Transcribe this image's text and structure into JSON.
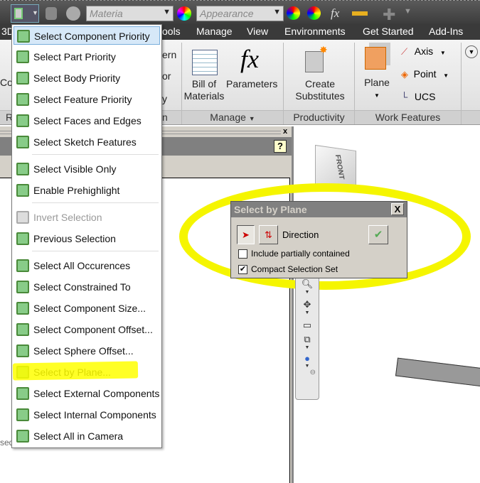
{
  "quick_access": {
    "material_placeholder": "Materia",
    "appearance_placeholder": "Appearance",
    "fx_icon": "fx"
  },
  "tabs": [
    "3D",
    "ools",
    "Manage",
    "View",
    "Environments",
    "Get Started",
    "Add-Ins"
  ],
  "ribbon": {
    "partial_labels": [
      "Co",
      "R",
      "ern",
      "or",
      "y",
      "n"
    ],
    "bill_of_materials": "Bill of Materials",
    "parameters": "Parameters",
    "create_substitutes": "Create Substitutes",
    "plane": "Plane",
    "axis": "Axis",
    "point": "Point",
    "ucs": "UCS",
    "groups": {
      "manage": "Manage",
      "productivity": "Productivity",
      "work_features": "Work Features"
    }
  },
  "panel": {
    "close": "x",
    "help": "?",
    "partial_text": "sed"
  },
  "menu": {
    "items": [
      {
        "label": "Select Component Priority",
        "highlighted": true
      },
      {
        "label": "Select Part Priority"
      },
      {
        "label": "Select Body Priority"
      },
      {
        "label": "Select Feature Priority"
      },
      {
        "label": "Select Faces and Edges"
      },
      {
        "label": "Select Sketch Features"
      },
      {
        "label": "Select Visible Only"
      },
      {
        "label": "Enable Prehighlight"
      },
      {
        "label": "Invert Selection",
        "disabled": true
      },
      {
        "label": "Previous Selection"
      },
      {
        "label": "Select All Occurences"
      },
      {
        "label": "Select Constrained To"
      },
      {
        "label": "Select Component Size..."
      },
      {
        "label": "Select Component Offset..."
      },
      {
        "label": "Select Sphere Offset..."
      },
      {
        "label": "Select by Plane..."
      },
      {
        "label": "Select External Components"
      },
      {
        "label": "Select Internal Components"
      },
      {
        "label": "Select All in Camera"
      }
    ]
  },
  "dialog": {
    "title": "Select by Plane",
    "close": "X",
    "direction": "Direction",
    "ok": "✔",
    "include_partial": {
      "label": "Include partially contained",
      "checked": false
    },
    "compact_set": {
      "label": "Compact Selection Set",
      "checked": true
    }
  },
  "viewcube": {
    "face": "FRONT"
  },
  "colors": {
    "highlight": "#ffff00",
    "menu_hover": "#d6e8f8",
    "ribbon_tabs": "#3a3a3a"
  }
}
